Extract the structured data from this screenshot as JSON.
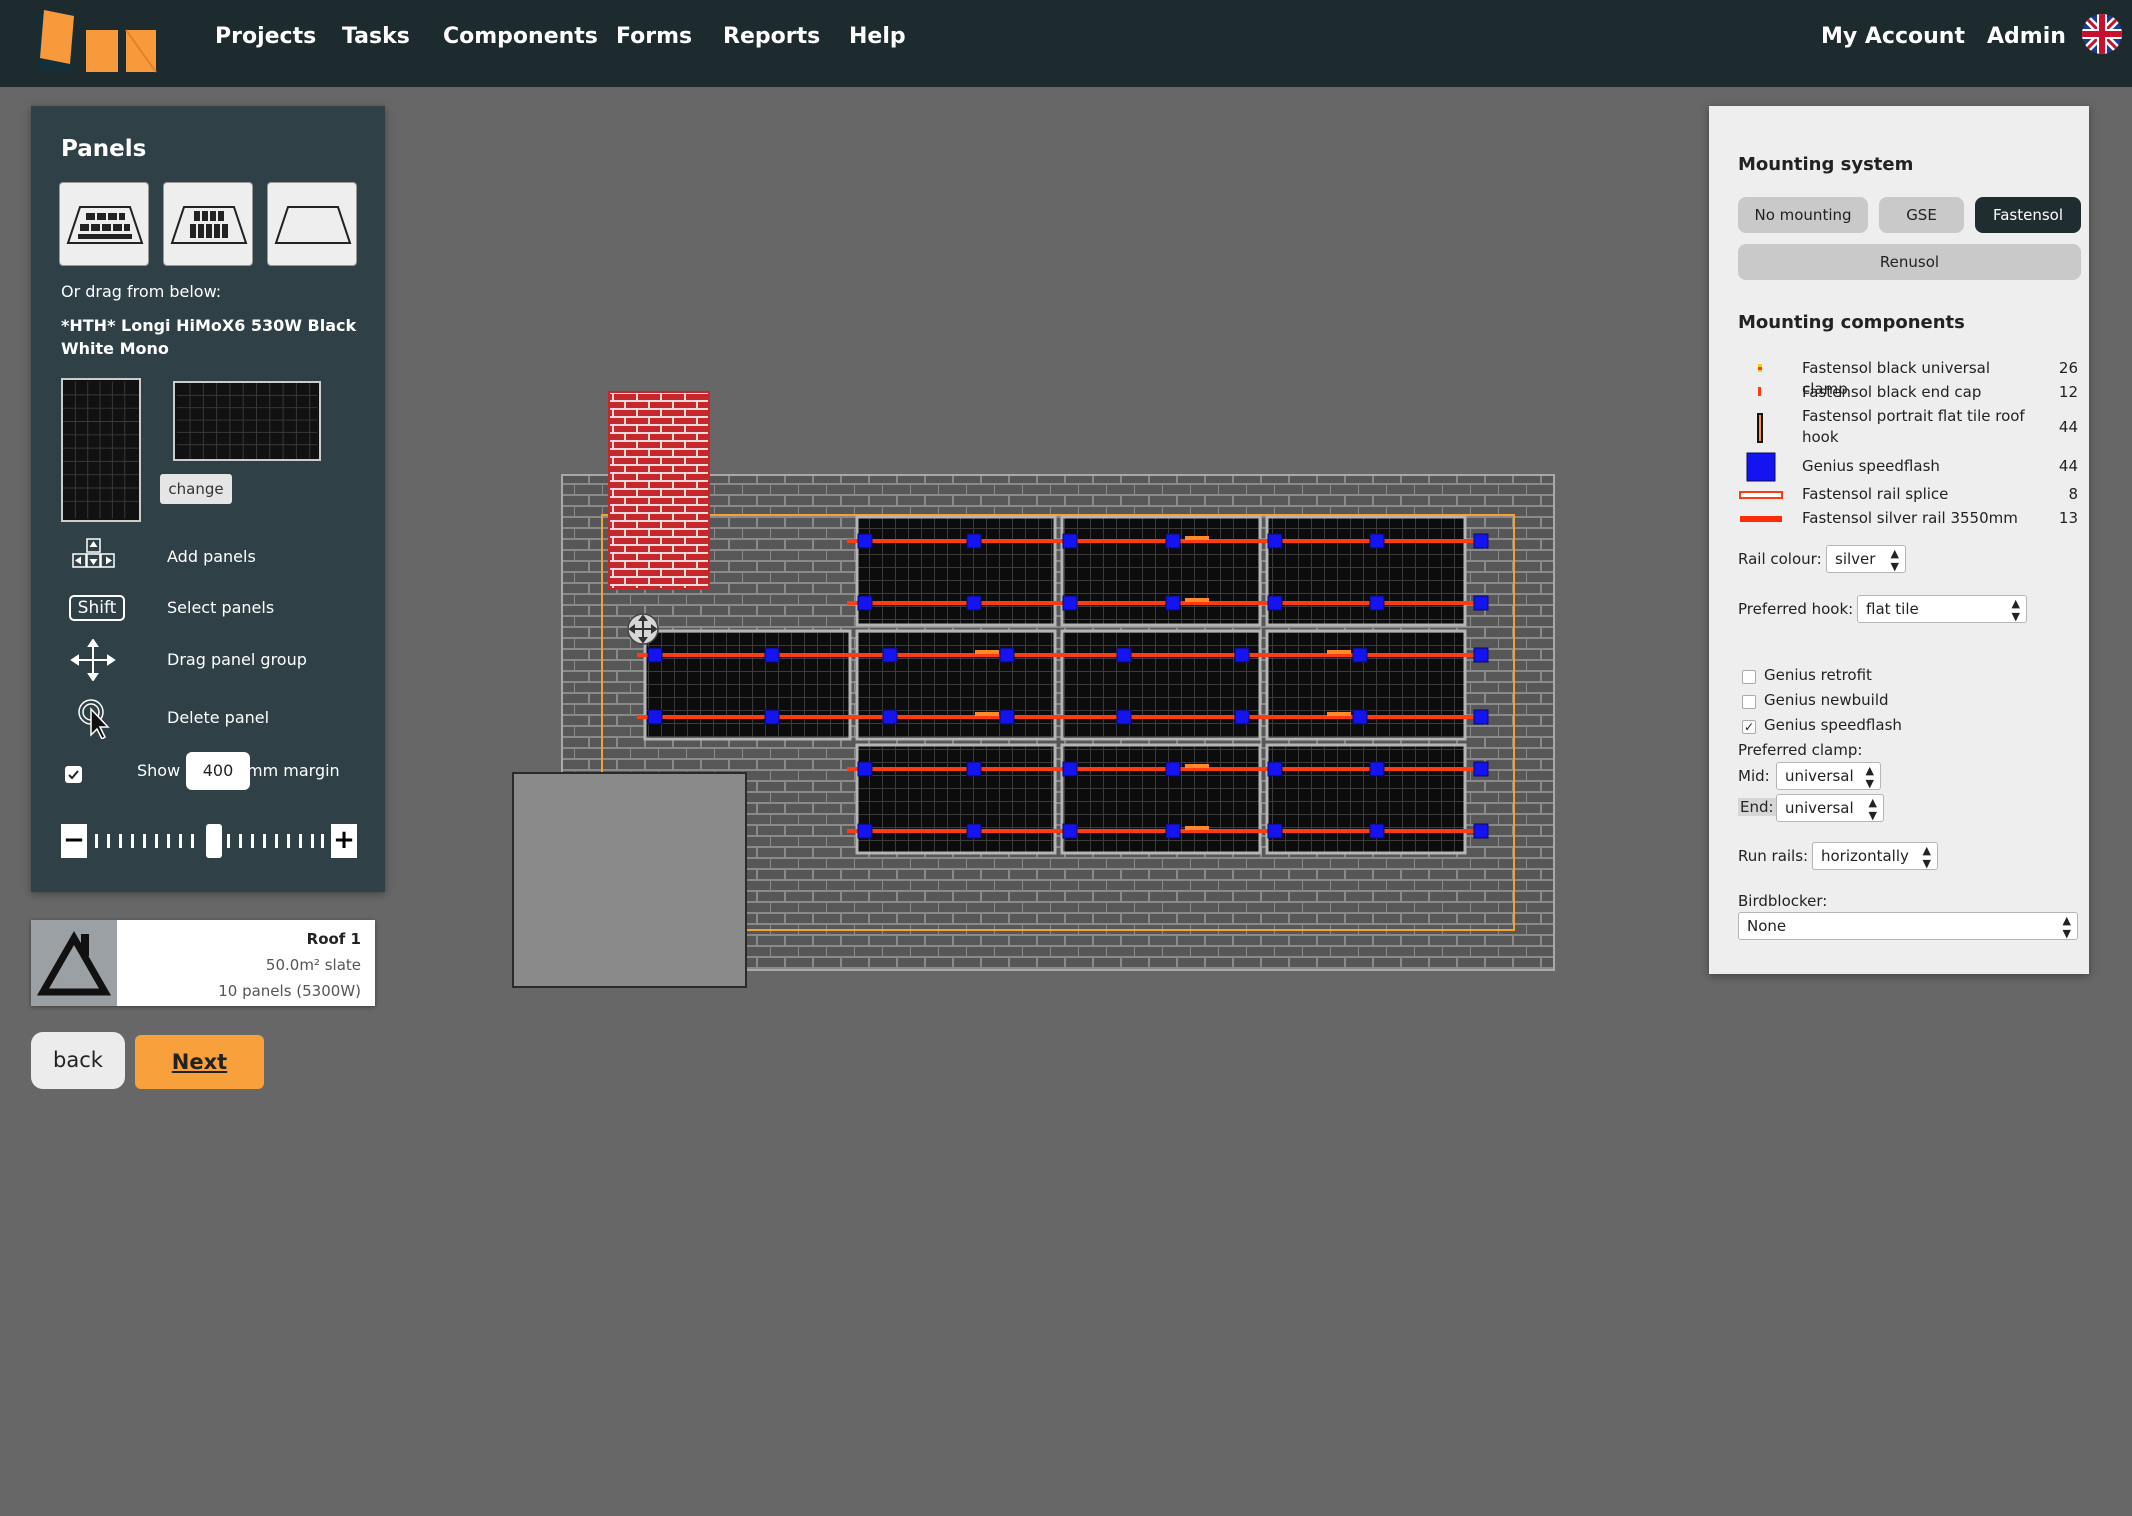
{
  "nav": {
    "links": [
      "Projects",
      "Tasks",
      "Components",
      "Forms",
      "Reports",
      "Help"
    ],
    "account": "My Account",
    "admin": "Admin",
    "language_icon": "uk-flag-icon"
  },
  "left_panel": {
    "title": "Panels",
    "drag_label": "Or drag from below:",
    "panel_model": "*HTH* Longi HiMoX6 530W Black White Mono",
    "change_label": "change",
    "help": {
      "add": "Add panels",
      "shift_key": "Shift",
      "select": "Select panels",
      "drag": "Drag panel group",
      "delete": "Delete panel"
    },
    "margin": {
      "checked": true,
      "show_label": "Show",
      "value": "400",
      "unit_label": "mm margin"
    },
    "zoom_level": 0.6
  },
  "roof_card": {
    "name": "Roof 1",
    "area": "50.0m² slate",
    "panels": "10 panels (5300W)"
  },
  "buttons": {
    "back": "back",
    "next": "Next"
  },
  "right_panel": {
    "mounting_system_heading": "Mounting system",
    "mounting_options": [
      {
        "label": "No mounting",
        "active": false
      },
      {
        "label": "GSE",
        "active": false
      },
      {
        "label": "Fastensol",
        "active": true
      },
      {
        "label": "Renusol",
        "active": false
      }
    ],
    "components_heading": "Mounting components",
    "components": [
      {
        "name": "Fastensol black universal clamp",
        "qty": "26",
        "symbol": "universal-clamp-icon"
      },
      {
        "name": "Fastensol black end cap",
        "qty": "12",
        "symbol": "end-cap-icon"
      },
      {
        "name": "Fastensol portrait flat tile roof hook",
        "qty": "44",
        "symbol": "roof-hook-icon"
      },
      {
        "name": "Genius speedflash",
        "qty": "44",
        "symbol": "speedflash-icon"
      },
      {
        "name": "Fastensol rail splice",
        "qty": "8",
        "symbol": "rail-splice-icon"
      },
      {
        "name": "Fastensol silver rail 3550mm",
        "qty": "13",
        "symbol": "rail-icon"
      }
    ],
    "rail_colour_label": "Rail colour:",
    "rail_colour": "silver",
    "preferred_hook_label": "Preferred hook:",
    "preferred_hook": "flat tile",
    "genius_options": [
      {
        "label": "Genius retrofit",
        "checked": false
      },
      {
        "label": "Genius newbuild",
        "checked": false
      },
      {
        "label": "Genius speedflash",
        "checked": true
      }
    ],
    "preferred_clamp_label": "Preferred clamp:",
    "mid_label": "Mid:",
    "mid_value": "universal",
    "end_label": "End:",
    "end_value": "universal",
    "run_rails_label": "Run rails:",
    "run_rails_value": "horizontally",
    "birdblocker_label": "Birdblocker:",
    "birdblocker_value": "None"
  },
  "colors": {
    "nav_bg": "#1d2a2e",
    "panel_bg": "#2f4146",
    "accent_orange": "#f7a03c",
    "rail": "#ff3b12",
    "speedflash": "#1414f0",
    "chimney": "#c8262d"
  }
}
